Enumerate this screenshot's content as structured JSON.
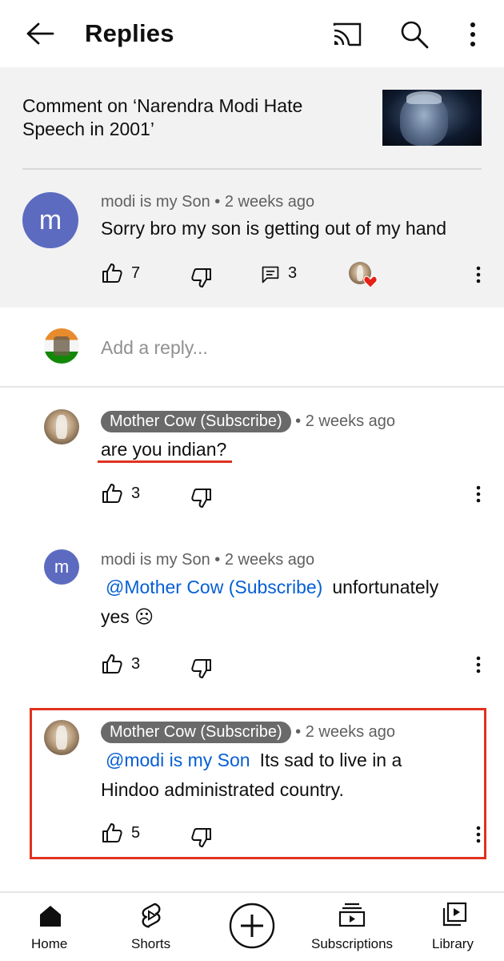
{
  "header": {
    "title": "Replies",
    "icons": [
      "back-arrow-icon",
      "cast-icon",
      "search-icon",
      "more-vert-icon"
    ]
  },
  "context": {
    "text": "Comment on ‘Narendra Modi Hate Speech in 2001’"
  },
  "main_comment": {
    "avatar_letter": "m",
    "author": "modi is my Son",
    "time": "2 weeks ago",
    "text": "Sorry bro my son is getting out of my hand",
    "likes": "7",
    "replies": "3"
  },
  "add_reply": {
    "placeholder": "Add a reply..."
  },
  "replies": [
    {
      "author": "Mother Cow (Subscribe)",
      "time": "2 weeks ago",
      "text": "are you indian?",
      "likes": "3"
    },
    {
      "avatar_letter": "m",
      "author": "modi is my Son",
      "time": "2 weeks ago",
      "mention": "@Mother Cow (Subscribe)",
      "text_line1": "unfortunately",
      "text_line2": "yes ☹",
      "likes": "3"
    },
    {
      "author": "Mother Cow (Subscribe)",
      "time": "2 weeks ago",
      "mention": "@modi is my Son",
      "text_line1": "Its sad to live in a",
      "text_line2": "Hindoo administrated country.",
      "likes": "5"
    }
  ],
  "nav": {
    "home": "Home",
    "shorts": "Shorts",
    "subscriptions": "Subscriptions",
    "library": "Library"
  },
  "colors": {
    "accent_red": "#e0321f",
    "mention_blue": "#065fd4",
    "avatar_purple": "#5c6bc0",
    "heart_red": "#e62117"
  }
}
